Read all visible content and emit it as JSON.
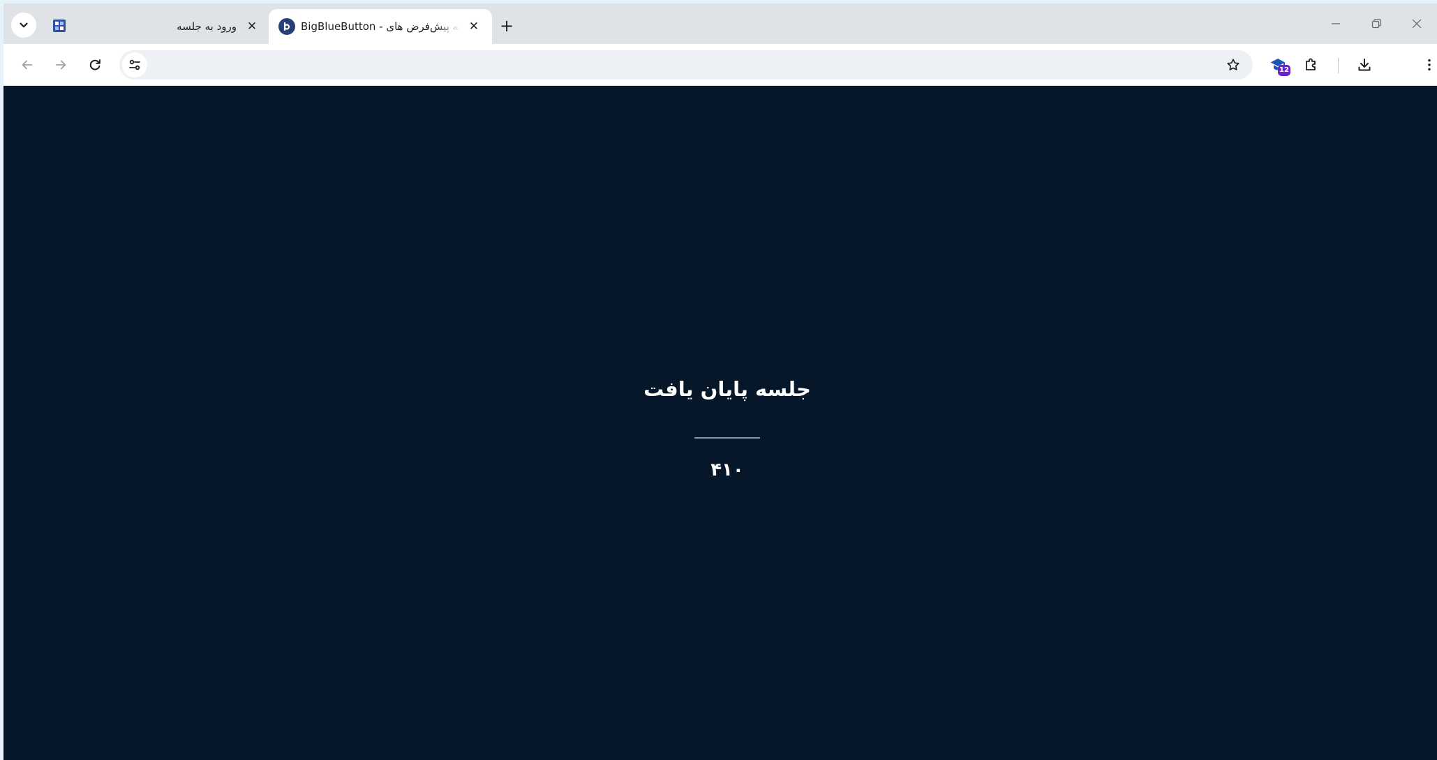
{
  "browser": {
    "tabs": [
      {
        "title": "ورود به جلسه",
        "active": false
      },
      {
        "title": "BigBlueButton - ارائه پیش‌فرض های",
        "active": true
      }
    ],
    "tab_close_glyph": "✕",
    "new_tab_glyph": "+",
    "address": {
      "url": ""
    },
    "extension_badge": "12",
    "icons": {
      "tab_search": "chevron-down-icon",
      "pinned_tab": "app-favicon-icon",
      "active_tab_favicon": "bigbluebutton-logo-icon",
      "back": "arrow-left-icon",
      "forward": "arrow-right-icon",
      "reload": "reload-icon",
      "site_info": "tune-icon",
      "bookmark": "star-icon",
      "extension": "graduation-cap-icon",
      "extensions_menu": "puzzle-icon",
      "downloads": "download-icon",
      "menu": "kebab-menu-icon",
      "minimize": "minimize-icon",
      "restore": "restore-icon",
      "close": "close-icon"
    }
  },
  "page": {
    "title": "جلسه پایان یافت",
    "code": "۴۱۰"
  },
  "colors": {
    "page_background": "#06172a",
    "tabstrip_background": "#dfe3e8",
    "toolbar_background": "#ffffff",
    "extension_badge": "#6b22c8"
  }
}
